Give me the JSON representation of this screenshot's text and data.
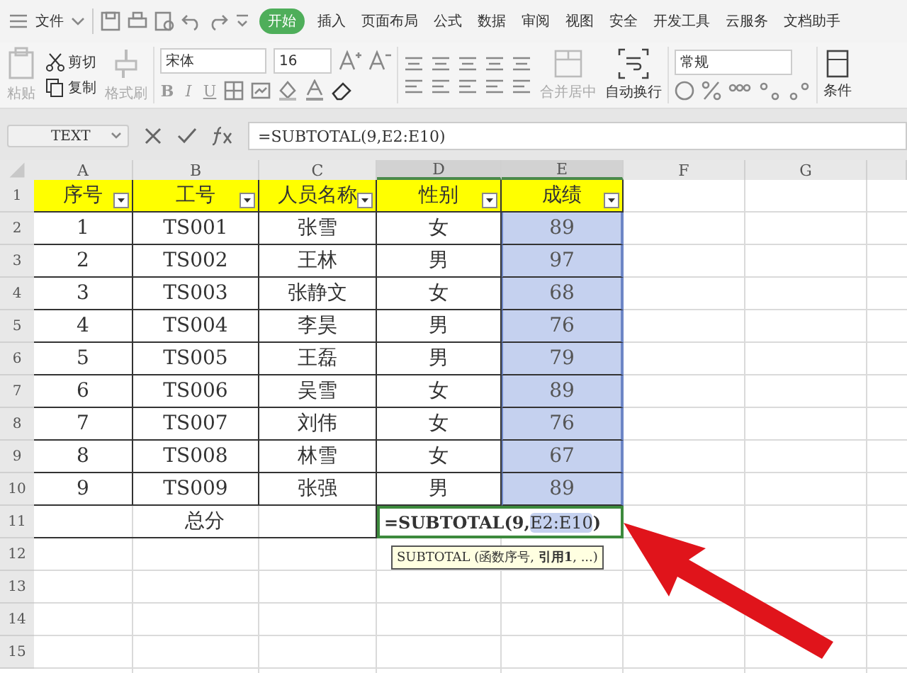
{
  "menu": {
    "file": "文件",
    "tabs": [
      {
        "label": "开始",
        "selected": true
      },
      {
        "label": "插入",
        "selected": false
      },
      {
        "label": "页面布局",
        "selected": false
      },
      {
        "label": "公式",
        "selected": false
      },
      {
        "label": "数据",
        "selected": false
      },
      {
        "label": "审阅",
        "selected": false
      },
      {
        "label": "视图",
        "selected": false
      },
      {
        "label": "安全",
        "selected": false
      },
      {
        "label": "开发工具",
        "selected": false
      },
      {
        "label": "云服务",
        "selected": false
      },
      {
        "label": "文档助手",
        "selected": false
      }
    ]
  },
  "ribbon": {
    "paste": {
      "label": "粘贴",
      "disabled": true
    },
    "cut": {
      "label": "剪切",
      "disabled": false
    },
    "copy": {
      "label": "复制",
      "disabled": false
    },
    "format_painter": {
      "label": "格式刷",
      "disabled": true
    },
    "font_name": "宋体",
    "font_size": "16",
    "style_buttons": [
      "B",
      "I",
      "U"
    ],
    "merge": {
      "label": "合并居中",
      "disabled": true
    },
    "wrap": {
      "label": "自动换行",
      "disabled": false
    },
    "number_format": "常规",
    "conditional": "条件"
  },
  "formula_bar": {
    "name_box": "TEXT",
    "formula": "=SUBTOTAL(9,E2:E10)"
  },
  "sheet": {
    "columns": [
      {
        "label": "A",
        "selected": false
      },
      {
        "label": "B",
        "selected": false
      },
      {
        "label": "C",
        "selected": false
      },
      {
        "label": "D",
        "selected": true
      },
      {
        "label": "E",
        "selected": true
      },
      {
        "label": "F",
        "selected": false
      },
      {
        "label": "G",
        "selected": false
      }
    ],
    "header": [
      "序号",
      "工号",
      "人员名称",
      "性别",
      "成绩"
    ],
    "rows": [
      {
        "cells": [
          "1",
          "TS001",
          "张雪",
          "女",
          "89"
        ],
        "selected": true
      },
      {
        "cells": [
          "2",
          "TS002",
          "王林",
          "男",
          "97"
        ],
        "selected": true
      },
      {
        "cells": [
          "3",
          "TS003",
          "张静文",
          "女",
          "68"
        ],
        "selected": true
      },
      {
        "cells": [
          "4",
          "TS004",
          "李昊",
          "男",
          "76"
        ],
        "selected": true
      },
      {
        "cells": [
          "5",
          "TS005",
          "王磊",
          "男",
          "79"
        ],
        "selected": true
      },
      {
        "cells": [
          "6",
          "TS006",
          "吴雪",
          "女",
          "89"
        ],
        "selected": true
      },
      {
        "cells": [
          "7",
          "TS007",
          "刘伟",
          "女",
          "76"
        ],
        "selected": true
      },
      {
        "cells": [
          "8",
          "TS008",
          "林雪",
          "女",
          "67"
        ],
        "selected": true
      },
      {
        "cells": [
          "9",
          "TS009",
          "张强",
          "男",
          "89"
        ],
        "selected": true
      }
    ],
    "total": {
      "label": "总分",
      "formula_parts": [
        {
          "text": "=SUBTOTAL(9, ",
          "highlighted": false
        },
        {
          "text": "E2:E10",
          "highlighted": true
        },
        {
          "text": ")",
          "highlighted": false
        }
      ]
    },
    "row_headers": [
      "1",
      "2",
      "3",
      "4",
      "5",
      "6",
      "7",
      "8",
      "9",
      "10",
      "11",
      "12",
      "13",
      "14",
      "15"
    ],
    "tooltip": "SUBTOTAL (函数序号, **引用1**, ...)"
  }
}
